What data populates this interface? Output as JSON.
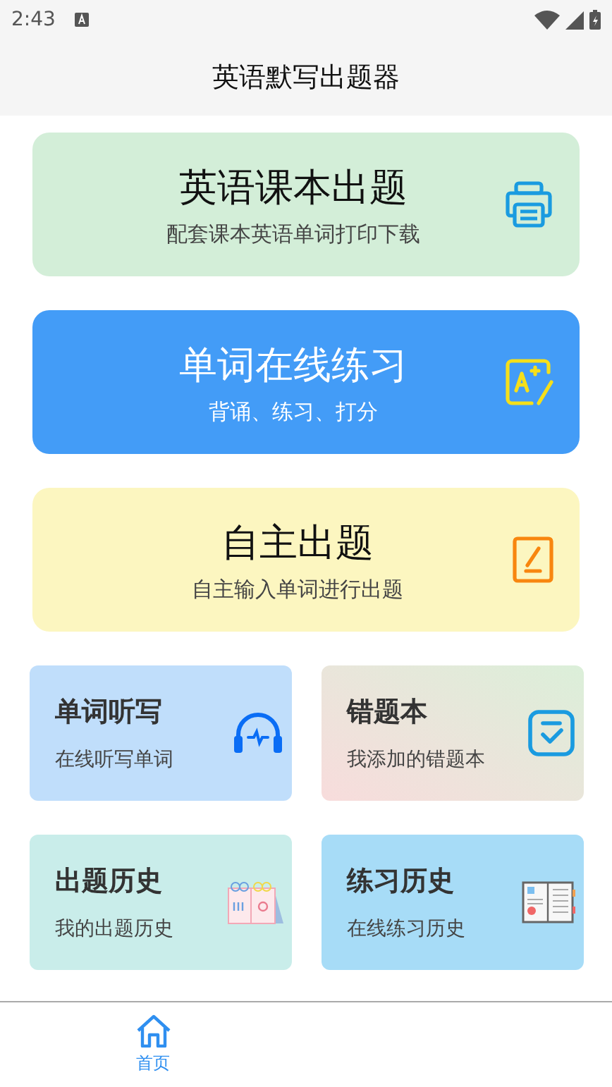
{
  "status_bar": {
    "time": "2:43"
  },
  "header": {
    "title": "英语默写出题器"
  },
  "main_cards": [
    {
      "title": "英语课本出题",
      "subtitle": "配套课本英语单词打印下载"
    },
    {
      "title": "单词在线练习",
      "subtitle": "背诵、练习、打分"
    },
    {
      "title": "自主出题",
      "subtitle": "自主输入单词进行出题"
    }
  ],
  "small_cards": [
    {
      "title": "单词听写",
      "subtitle": "在线听写单词"
    },
    {
      "title": "错题本",
      "subtitle": "我添加的错题本"
    },
    {
      "title": "出题历史",
      "subtitle": "我的出题历史"
    },
    {
      "title": "练习历史",
      "subtitle": "在线练习历史"
    }
  ],
  "bottom_nav": [
    {
      "label": "首页",
      "selected": true
    }
  ]
}
